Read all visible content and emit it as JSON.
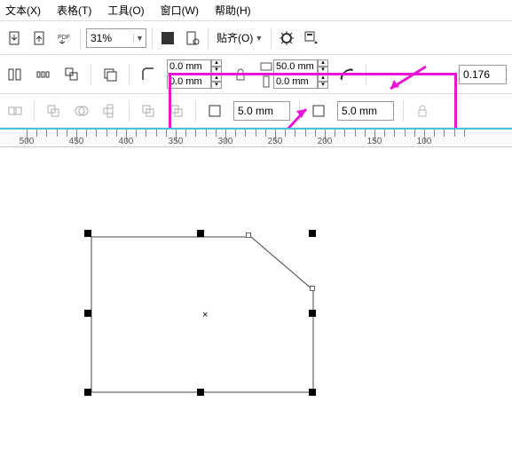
{
  "menu": {
    "text": "文本(X)",
    "table": "表格(T)",
    "tools": "工具(O)",
    "window": "窗口(W)",
    "help": "帮助(H)"
  },
  "toolbar1": {
    "zoom": "31%",
    "snap_label": "贴齐(O)"
  },
  "toolbar2": {
    "offset": {
      "x": "0.0 mm",
      "y": "0.0 mm"
    },
    "size": {
      "w": "50.0 mm",
      "h": "0.0 mm"
    },
    "stroke": "0.176"
  },
  "toolbar3": {
    "radius1": "5.0 mm",
    "radius2": "5.0 mm"
  },
  "ruler": [
    500,
    450,
    400,
    350,
    300,
    250,
    200,
    150,
    100
  ],
  "chart_data": null
}
